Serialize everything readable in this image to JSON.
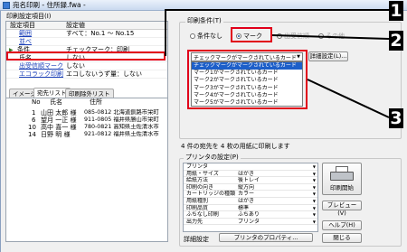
{
  "window": {
    "title": "宛名印刷 - 住所録.fwa -"
  },
  "settings": {
    "title": "印刷設定項目(I)",
    "headers": [
      "設定項目",
      "設定値"
    ],
    "rows": [
      {
        "item": "範囲",
        "value": "すべて：No.1 〜 No.15"
      },
      {
        "item": "並べ",
        "value": ""
      },
      {
        "item": "条件",
        "value": "チェックマーク：印刷"
      },
      {
        "item": "氏名",
        "value": "しない"
      },
      {
        "item": "出受信順マーク",
        "value": "しない"
      },
      {
        "item": "エコラック印刷",
        "value": "エコしないうず量：しない"
      }
    ]
  },
  "tabs": [
    "イメージ",
    "宛先リスト",
    "印刷除外リスト"
  ],
  "list": {
    "headers": [
      "No",
      "氏名",
      "住所"
    ],
    "rows": [
      {
        "no": "1",
        "name": "山田 太郎 様",
        "addr": "085-0812 北海道釧路市栄町"
      },
      {
        "no": "6",
        "name": "望月 一正 様",
        "addr": "911-0805 福井県勝山市栄町"
      },
      {
        "no": "10",
        "name": "高中 喜一 様",
        "addr": "780-0821 高知県土佐清水市"
      },
      {
        "no": "14",
        "name": "日野 明 様",
        "addr": "921-0812 福井県土佐清水市"
      }
    ]
  },
  "condition": {
    "title": "印刷条件(T)",
    "radios": [
      "条件なし",
      "マーク",
      "出受信順",
      "その他"
    ],
    "selected": 1,
    "dropdown_value": "チェックマークがマークされているカード",
    "detail_button": "詳細設定(L)...",
    "options": [
      "チェックマークがマークされているカード",
      "マーク1がマークされているカード",
      "マーク2がマークされているカード",
      "マーク3がマークされているカード",
      "マーク4がマークされているカード",
      "マーク5がマークされているカード"
    ]
  },
  "status": "4 件の宛先を 4 枚の用紙に印刷します",
  "printer": {
    "title": "プリンタの設定(P)",
    "rows": [
      {
        "k": "プリンタ",
        "v": ""
      },
      {
        "k": "用紙・サイズ",
        "v": "はがき"
      },
      {
        "k": "給紙方法",
        "v": "後トレイ"
      },
      {
        "k": "印刷の向き",
        "v": "縦方向"
      },
      {
        "k": "カートリッジの種類",
        "v": "カラー"
      },
      {
        "k": "用紙種別",
        "v": "はがき"
      },
      {
        "k": "印刷品質",
        "v": "標準"
      },
      {
        "k": "ふちなし印刷",
        "v": "ふちあり"
      },
      {
        "k": "出力先",
        "v": "プリンタ"
      }
    ],
    "detail": "詳細設定",
    "properties": "プリンタのプロパティ..."
  },
  "buttons": {
    "print": "印刷開始",
    "preview": "プレビュー(V)",
    "help": "ヘルプ(H)",
    "close": "閉じる"
  },
  "callouts": [
    "1",
    "2",
    "3"
  ],
  "colors": {
    "callout_red": "#e1001a",
    "selected": "#1d5fc9"
  }
}
